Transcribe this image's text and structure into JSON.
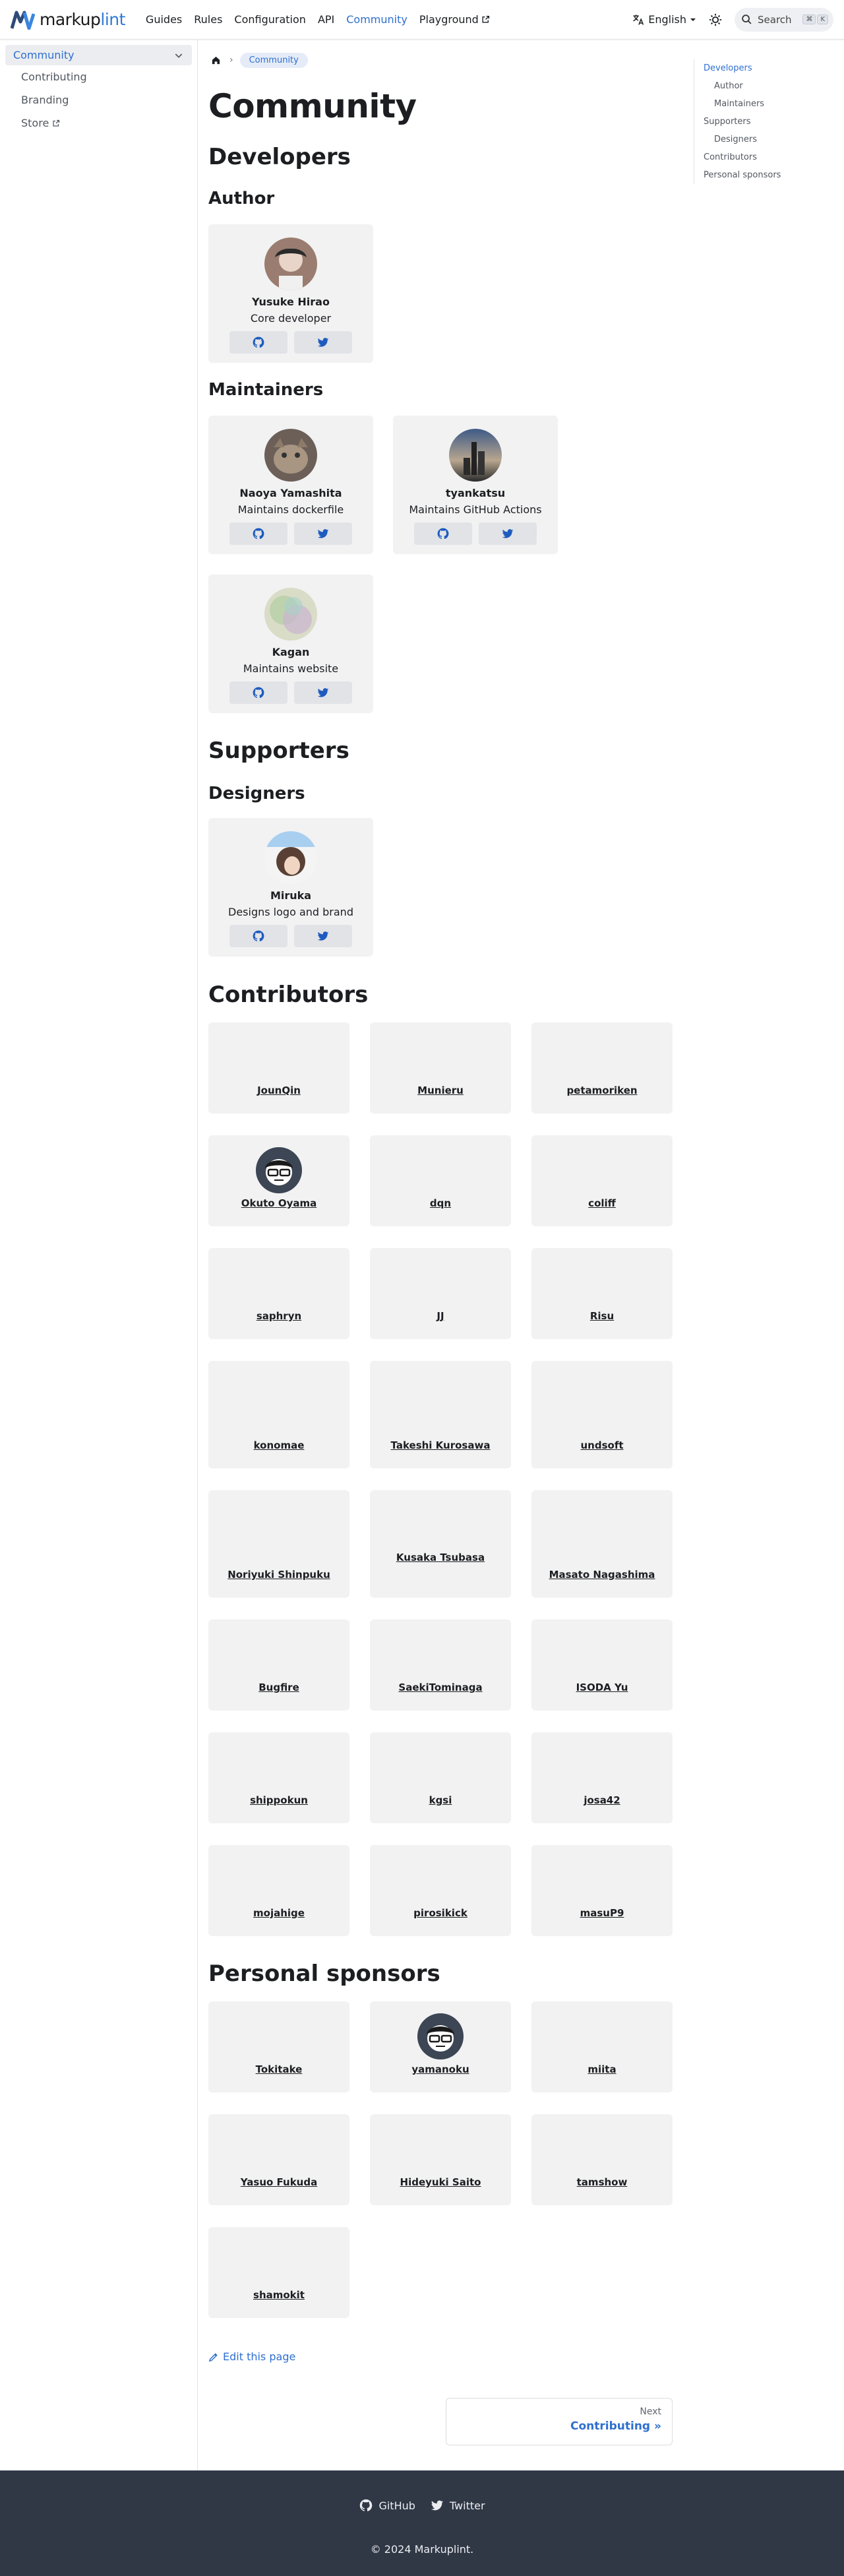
{
  "header": {
    "brand_prefix": "markup",
    "brand_suffix": "lint",
    "nav": [
      {
        "label": "Guides"
      },
      {
        "label": "Rules"
      },
      {
        "label": "Configuration"
      },
      {
        "label": "API"
      },
      {
        "label": "Community"
      },
      {
        "label": "Playground"
      }
    ],
    "language": "English",
    "search_label": "Search",
    "search_keys": [
      "⌘",
      "K"
    ]
  },
  "sidebar": {
    "category": "Community",
    "items": [
      {
        "label": "Contributing"
      },
      {
        "label": "Branding"
      },
      {
        "label": "Store"
      }
    ]
  },
  "breadcrumb": {
    "current": "Community"
  },
  "page": {
    "title": "Community",
    "developers_heading": "Developers",
    "author_heading": "Author",
    "maintainers_heading": "Maintainers",
    "supporters_heading": "Supporters",
    "designers_heading": "Designers",
    "contributors_heading": "Contributors",
    "sponsors_heading": "Personal sponsors"
  },
  "author": {
    "name": "Yusuke Hirao",
    "role": "Core developer"
  },
  "maintainers": [
    {
      "name": "Naoya Yamashita",
      "role": "Maintains dockerfile"
    },
    {
      "name": "tyankatsu",
      "role": "Maintains GitHub Actions"
    },
    {
      "name": "Kagan",
      "role": "Maintains website"
    }
  ],
  "designer": {
    "name": "Miruka",
    "role": "Designs logo and brand"
  },
  "contributors": [
    "JounQin",
    "Munieru",
    "petamoriken",
    "Okuto Oyama",
    "dqn",
    "coliff",
    "saphryn",
    "JJ",
    "Risu",
    "konomae",
    "Takeshi Kurosawa",
    "undsoft",
    "Noriyuki Shinpuku",
    "Kusaka Tsubasa",
    "Masato Nagashima",
    "Bugfire",
    "SaekiTominaga",
    "ISODA Yu",
    "shippokun",
    "kgsi",
    "josa42",
    "mojahige",
    "pirosikick",
    "masuP9"
  ],
  "sponsors": [
    "Tokitake",
    "yamanoku",
    "miita",
    "Yasuo Fukuda",
    "Hideyuki Saito",
    "tamshow",
    "shamokit"
  ],
  "toc": [
    {
      "label": "Developers"
    },
    {
      "label": "Author"
    },
    {
      "label": "Maintainers"
    },
    {
      "label": "Supporters"
    },
    {
      "label": "Designers"
    },
    {
      "label": "Contributors"
    },
    {
      "label": "Personal sponsors"
    }
  ],
  "edit_link": "Edit this page",
  "pager": {
    "sublabel": "Next",
    "label": "Contributing »"
  },
  "footer": {
    "links": [
      {
        "label": "GitHub"
      },
      {
        "label": "Twitter"
      }
    ],
    "copyright": "© 2024 Markuplint."
  },
  "colors": {
    "accent": "#2e6fd0",
    "card_bg": "#f2f2f3",
    "footer_bg": "#303846"
  }
}
